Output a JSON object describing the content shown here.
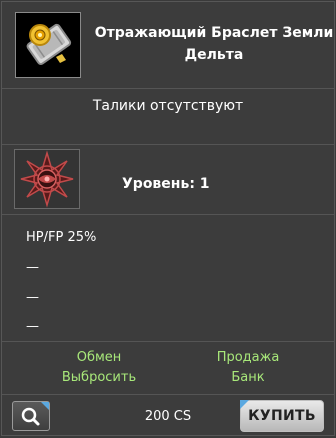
{
  "item": {
    "title": "Отражающий Браслет Земли Дельта",
    "icon": "bracelet-icon"
  },
  "talismans_text": "Талики отсутствуют",
  "level": {
    "emblem_icon": "star-emblem-icon",
    "text": "Уровень: 1"
  },
  "stats": [
    "HP/FP 25%",
    "—",
    "—",
    "—"
  ],
  "actions": {
    "exchange": "Обмен",
    "sell": "Продажа",
    "discard": "Выбросить",
    "bank": "Банк"
  },
  "footer": {
    "search_icon": "search-icon",
    "price": "200 CS",
    "buy_label": "КУПИТЬ"
  },
  "colors": {
    "background": "#3c3c3c",
    "action_text": "#a8e87a",
    "corner_accent": "#5aa8e0"
  }
}
